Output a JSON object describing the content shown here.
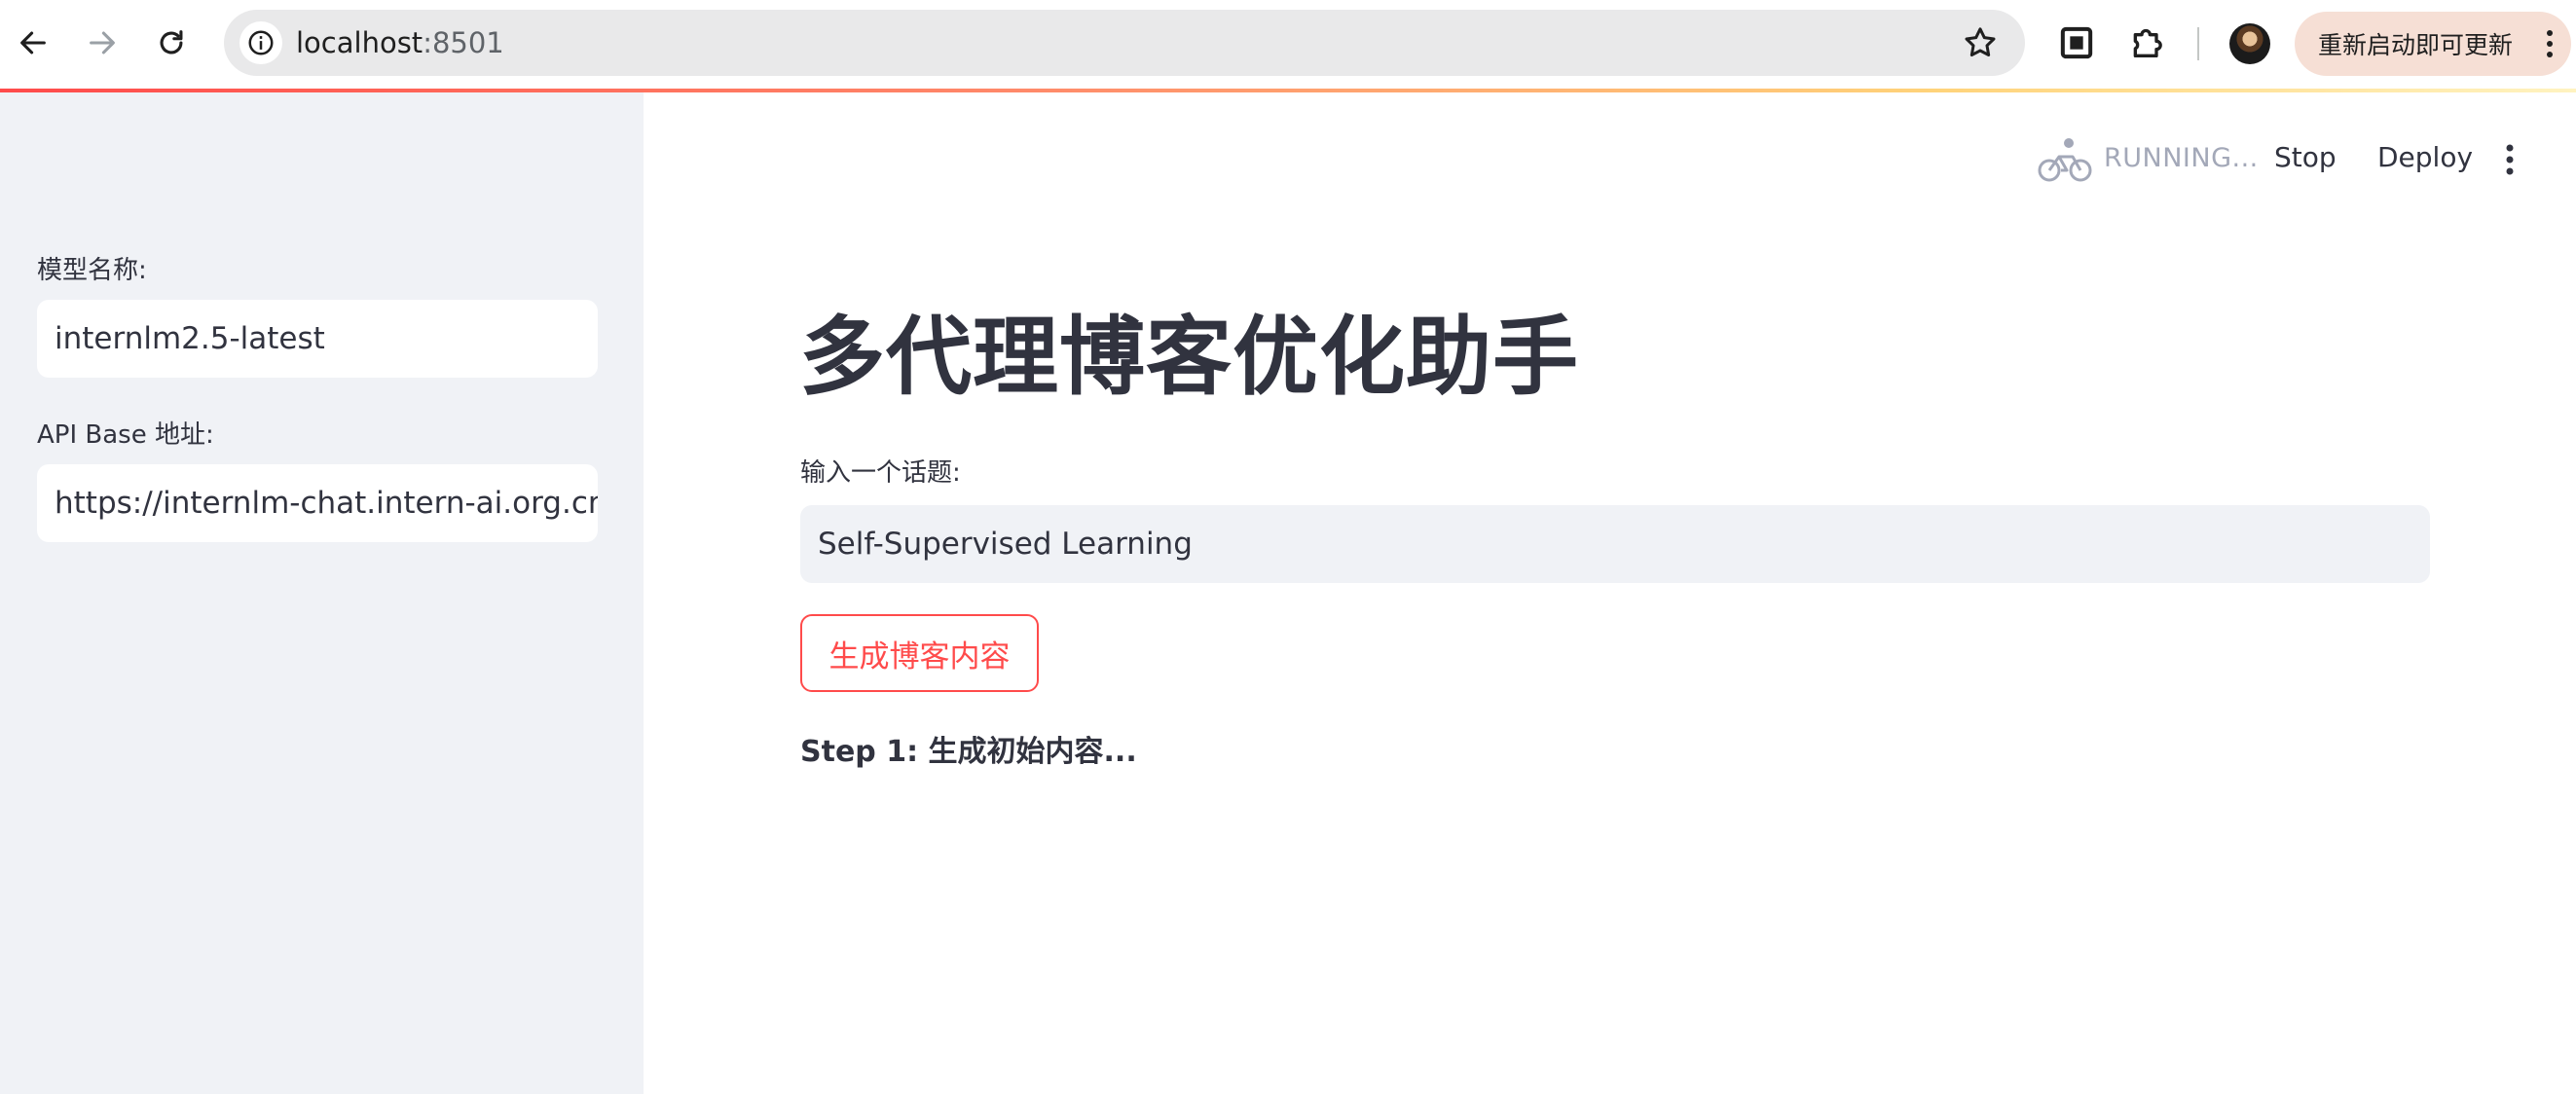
{
  "browser": {
    "url_host": "localhost",
    "url_port": ":8501",
    "update_button_label": "重新启动即可更新",
    "icons": {
      "back": "arrow-left-icon",
      "forward": "arrow-right-icon",
      "reload": "reload-icon",
      "info": "info-icon",
      "bookmark": "star-icon",
      "screen": "screen-icon",
      "extensions": "puzzle-icon",
      "menu": "kebab-menu-icon"
    }
  },
  "app": {
    "status": {
      "running_text": "RUNNING...",
      "stop_label": "Stop",
      "deploy_label": "Deploy"
    },
    "sidebar": {
      "model_label": "模型名称:",
      "model_value": "internlm2.5-latest",
      "api_label": "API Base 地址:",
      "api_value": "https://internlm-chat.intern-ai.org.cn/pu"
    },
    "main": {
      "title": "多代理博客优化助手",
      "topic_label": "输入一个话题:",
      "topic_value": "Self-Supervised Learning",
      "generate_button_label": "生成博客内容",
      "step_text": "Step 1: 生成初始内容..."
    }
  },
  "colors": {
    "accent": "#ff4b4b",
    "sidebar_bg": "#f0f2f6",
    "text": "#31333f",
    "muted": "#a3a8b8",
    "update_button_bg": "#f6dfd5"
  }
}
